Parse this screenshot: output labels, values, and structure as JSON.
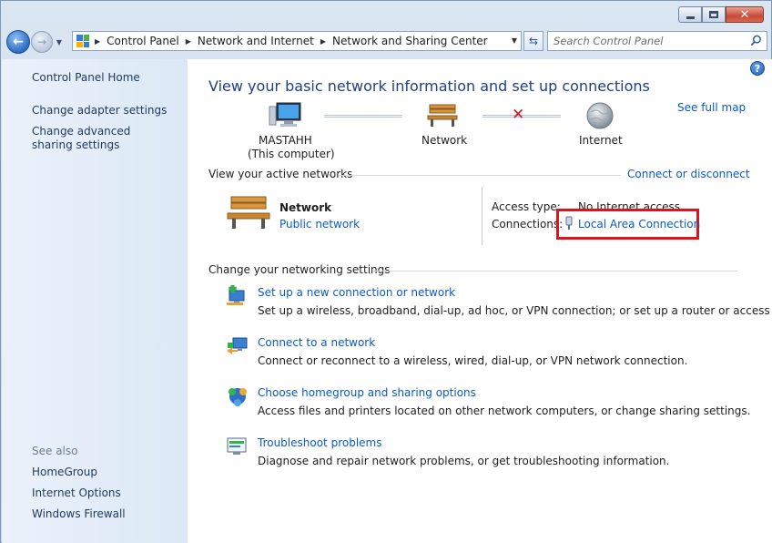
{
  "window": {
    "caption_buttons": [
      "minimize",
      "maximize",
      "close"
    ]
  },
  "address_bar": {
    "crumbs": [
      "Control Panel",
      "Network and Internet",
      "Network and Sharing Center"
    ]
  },
  "search": {
    "placeholder": "Search Control Panel"
  },
  "sidebar": {
    "links": [
      "Control Panel Home",
      "Change adapter settings",
      "Change advanced sharing settings"
    ],
    "see_also_heading": "See also",
    "see_also": [
      "HomeGroup",
      "Internet Options",
      "Windows Firewall"
    ]
  },
  "main": {
    "title": "View your basic network information and set up connections",
    "see_full_map": "See full map",
    "map": {
      "computer_name": "MASTAHH",
      "computer_sub": "(This computer)",
      "network": "Network",
      "internet": "Internet"
    },
    "active_networks": {
      "heading": "View your active networks",
      "connect_link": "Connect or disconnect",
      "network_name": "Network",
      "network_type": "Public network",
      "access_type_label": "Access type:",
      "access_type_value": "No Internet access",
      "connections_label": "Connections:",
      "connection_link": "Local Area Connection"
    },
    "settings": {
      "heading": "Change your networking settings",
      "tasks": [
        {
          "title": "Set up a new connection or network",
          "desc": "Set up a wireless, broadband, dial-up, ad hoc, or VPN connection; or set up a router or access point."
        },
        {
          "title": "Connect to a network",
          "desc": "Connect or reconnect to a wireless, wired, dial-up, or VPN network connection."
        },
        {
          "title": "Choose homegroup and sharing options",
          "desc": "Access files and printers located on other network computers, or change sharing settings."
        },
        {
          "title": "Troubleshoot problems",
          "desc": "Diagnose and repair network problems, or get troubleshooting information."
        }
      ]
    }
  },
  "colors": {
    "link": "#0b59c5",
    "title": "#1e3f8a",
    "highlight": "#e0121b"
  }
}
